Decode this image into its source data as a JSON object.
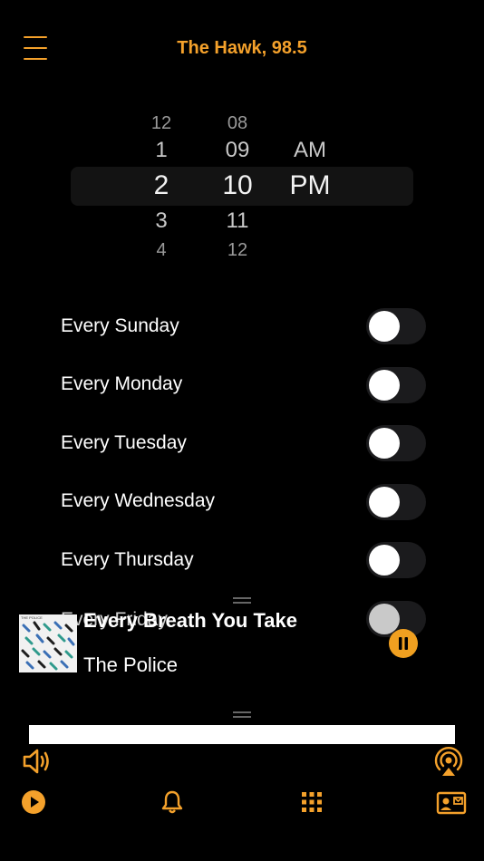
{
  "header": {
    "title": "The Hawk, 98.5",
    "menu_icon": "hamburger-menu-icon"
  },
  "time_picker": {
    "hours": [
      "12",
      "1",
      "2",
      "3",
      "4"
    ],
    "minutes": [
      "08",
      "09",
      "10",
      "11",
      "12"
    ],
    "periods": [
      "AM",
      "PM"
    ],
    "selected": {
      "hour": "2",
      "minute": "10",
      "period": "PM"
    }
  },
  "days": [
    {
      "label": "Every Sunday",
      "enabled": false
    },
    {
      "label": "Every Monday",
      "enabled": false
    },
    {
      "label": "Every Tuesday",
      "enabled": false
    },
    {
      "label": "Every Wednesday",
      "enabled": false
    },
    {
      "label": "Every Thursday",
      "enabled": false
    },
    {
      "label": "Every Friday",
      "enabled": false
    }
  ],
  "now_playing": {
    "track": "Every Breath You Take",
    "artist": "The Police",
    "album_art_caption": "THE POLICE",
    "pause_icon": "pause-icon"
  },
  "bottom_bar": {
    "volume_icon": "volume-icon",
    "airplay_icon": "airplay-icon",
    "tabs": [
      "play-tab",
      "alarm-bell-tab",
      "keypad-grid-tab",
      "contact-card-tab"
    ]
  },
  "colors": {
    "accent": "#f4a12b",
    "background": "#000000",
    "toggle_track": "#1b1b1d"
  }
}
